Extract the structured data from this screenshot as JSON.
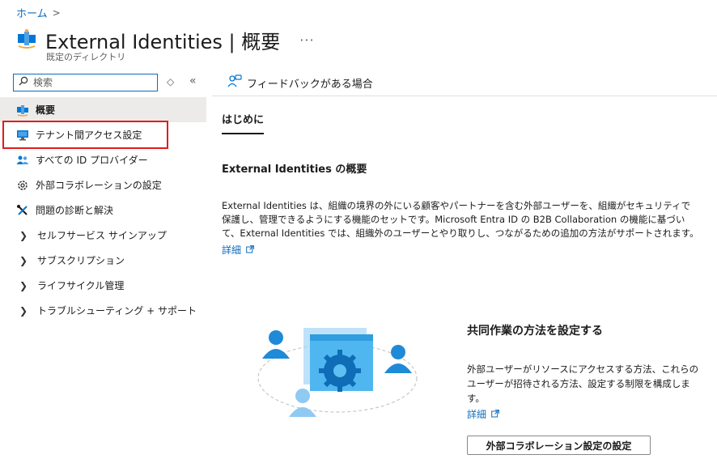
{
  "breadcrumb": {
    "home": "ホーム",
    "separator": ">"
  },
  "header": {
    "title": "External Identities | 概要",
    "more": "···",
    "subtitle": "既定のディレクトリ"
  },
  "search": {
    "placeholder": "検索",
    "sort_icon": "◇",
    "collapse_icon": "«"
  },
  "sidebar": {
    "items": [
      {
        "label": "概要",
        "icon": "external-identities-icon"
      },
      {
        "label": "テナント間アクセス設定",
        "icon": "monitor-icon"
      },
      {
        "label": "すべての ID プロバイダー",
        "icon": "users-icon"
      },
      {
        "label": "外部コラボレーションの設定",
        "icon": "gear-icon"
      },
      {
        "label": "問題の診断と解決",
        "icon": "wrench-icon"
      },
      {
        "label": "セルフサービス サインアップ",
        "icon": "chevron-right-icon"
      },
      {
        "label": "サブスクリプション",
        "icon": "chevron-right-icon"
      },
      {
        "label": "ライフサイクル管理",
        "icon": "chevron-right-icon"
      },
      {
        "label": "トラブルシューティング + サポート",
        "icon": "chevron-right-icon"
      }
    ]
  },
  "main": {
    "feedback": "フィードバックがある場合",
    "tab": "はじめに",
    "overview_heading": "External Identities の概要",
    "overview_text": "External Identities は、組織の境界の外にいる顧客やパートナーを含む外部ユーザーを、組織がセキュリティで保護し、管理できるようにする機能のセットです。Microsoft Entra ID の B2B Collaboration の機能に基づいて、External Identities では、組織外のユーザーとやり取りし、つながるための追加の方法がサポートされます。",
    "details_link": "詳細",
    "collab_heading": "共同作業の方法を設定する",
    "collab_text": "外部ユーザーがリソースにアクセスする方法、これらのユーザーが招待される方法、設定する制限を構成します。",
    "collab_link": "詳細",
    "collab_button": "外部コラボレーション設定の設定"
  },
  "colors": {
    "accent": "#0f6cbd",
    "highlight": "#e21c1c",
    "active_bg": "#edebe9"
  }
}
